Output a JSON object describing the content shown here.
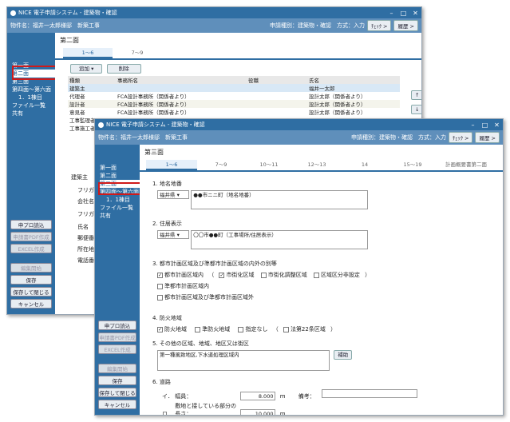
{
  "back": {
    "titlebar": "NICE 電子申請システム - 建築物・確認",
    "header": {
      "property": "物件名：福井一太郎様邸　新築工事",
      "kind": "申請種別：建築物・確認　方式：入力",
      "check": "ﾁｪｯｸ >",
      "history": "履歴 >"
    },
    "page_title": "第二面",
    "tabs": [
      "1～6",
      "7～9"
    ],
    "sidebar": {
      "items": [
        "第一面",
        "第二面",
        "第三面",
        "第四面～第六面",
        "1．1棟目",
        "ファイル一覧",
        "共有"
      ],
      "buttons": [
        "申プロ読込",
        "申請書PDF作成",
        "EXCEL作成",
        "編集開始",
        "保存",
        "保存して閉じる",
        "キャンセル"
      ]
    },
    "toolbar": {
      "add": "追加",
      "delete": "削除"
    },
    "table": {
      "headers": [
        "種類",
        "事務所名",
        "役職",
        "氏名"
      ],
      "rows": [
        [
          "建築主",
          "",
          "",
          "福井一太郎"
        ],
        [
          "代理者",
          "FCA設計事務所（関係者より）",
          "",
          "設計太郎（関係者より）"
        ],
        [
          "設計者",
          "FCA設計事務所（関係者より）",
          "",
          "設計太郎（関係者より）"
        ],
        [
          "意見者",
          "FCA設計事務所（関係者より）",
          "",
          "設計太郎（関係者より）"
        ],
        [
          "工事監理者",
          "",
          "",
          ""
        ],
        [
          "工事施工者",
          "",
          "",
          ""
        ]
      ]
    },
    "lower_labels": [
      "建築主",
      "フリガナ",
      "会社名",
      "フリガナ",
      "氏名",
      "郵便番号",
      "所在地",
      "電話番号"
    ],
    "arrows": [
      "↑",
      "↓"
    ]
  },
  "front": {
    "titlebar": "NICE 電子申請システム - 建築物・確認",
    "header": {
      "property": "物件名：福井一太郎様邸　新築工事",
      "kind": "申請種別：建築物・確認　方式：入力",
      "check": "ﾁｪｯｸ >",
      "history": "履歴 >"
    },
    "page_title": "第三面",
    "tabs": [
      "1～6",
      "7～9",
      "10～11",
      "12～13",
      "14",
      "15～19",
      "計画概要書第二面"
    ],
    "sidebar": {
      "items": [
        "第一面",
        "第二面",
        "第三面",
        "第四面～第六面",
        "1．1棟目",
        "ファイル一覧",
        "共有"
      ],
      "buttons": [
        "申プロ読込",
        "申請書PDF作成",
        "EXCEL作成",
        "編集開始",
        "保存",
        "保存して閉じる",
        "キャンセル"
      ]
    },
    "s1": {
      "title": "1. 地名地番",
      "pref": "福井県",
      "value": "●●市ニニ町（地名地番）"
    },
    "s2": {
      "title": "2. 住居表示",
      "pref": "福井県",
      "value": "〇〇市●●町（工事場所/住居表示）"
    },
    "s3": {
      "title": "3. 都市計画区域及び準都市計画区域の内外の別等",
      "c1": "都市計画区域内",
      "paren_open": "（",
      "c2": "市街化区域",
      "c3": "市街化調整区域",
      "c4": "区域区分非設定",
      "paren_close": "）",
      "c5": "準都市計画区域内",
      "c6": "都市計画区域及び準都市計画区域外"
    },
    "s4": {
      "title": "4. 防火地域",
      "c1": "防火地域",
      "c2": "準防火地域",
      "c3": "指定なし",
      "paren_open": "（",
      "c4": "法第22条区域",
      "paren_close": "）"
    },
    "s5": {
      "title": "5. その他の区域、地域、地区又は街区",
      "value": "第一種風致地区,下水道処理区域内",
      "assist": "補助"
    },
    "s6": {
      "title": "6. 道路",
      "i_label": "イ．",
      "width_label": "幅員：",
      "width_value": "8.000",
      "width_unit": "m",
      "note_label": "備考：",
      "ro_label": "ロ．",
      "contact_label": "敷地と接している部分の長さ：",
      "contact_value": "10.000",
      "contact_unit": "m"
    }
  }
}
